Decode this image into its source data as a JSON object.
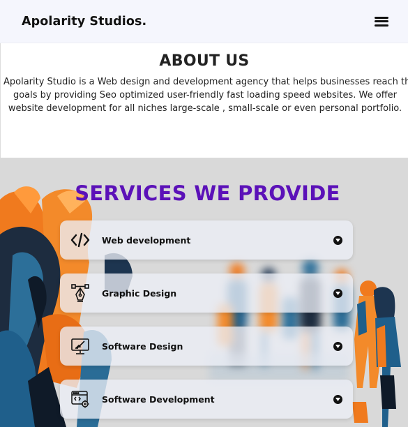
{
  "navbar": {
    "brand": "Apolarity Studios.",
    "menu_icon": "hamburger-menu-icon"
  },
  "about": {
    "title": "ABOUT US",
    "lines": [
      "Apolarity Studio is a Web design and development agency that helps businesses reach their",
      "goals by providing Seo optimized user-friendly fast loading speed websites. We offer",
      "website development for all niches large-scale , small-scale or even personal portfolio."
    ]
  },
  "services": {
    "title": "SERVICES WE PROVIDE",
    "title_color": "#5b11b8",
    "items": [
      {
        "label": "Web development",
        "icon": "code-icon"
      },
      {
        "label": "Graphic Design",
        "icon": "pen-tool-icon"
      },
      {
        "label": "Software Design",
        "icon": "monitor-design-icon"
      },
      {
        "label": "Software Development",
        "icon": "browser-gear-icon"
      }
    ],
    "expand_icon": "chevron-down-circle-icon"
  },
  "colors": {
    "nav_bg": "#f5f6fd",
    "services_bg": "#d9d9d9",
    "accent_orange": "#f07a1e",
    "accent_blue": "#1f5f8b"
  }
}
